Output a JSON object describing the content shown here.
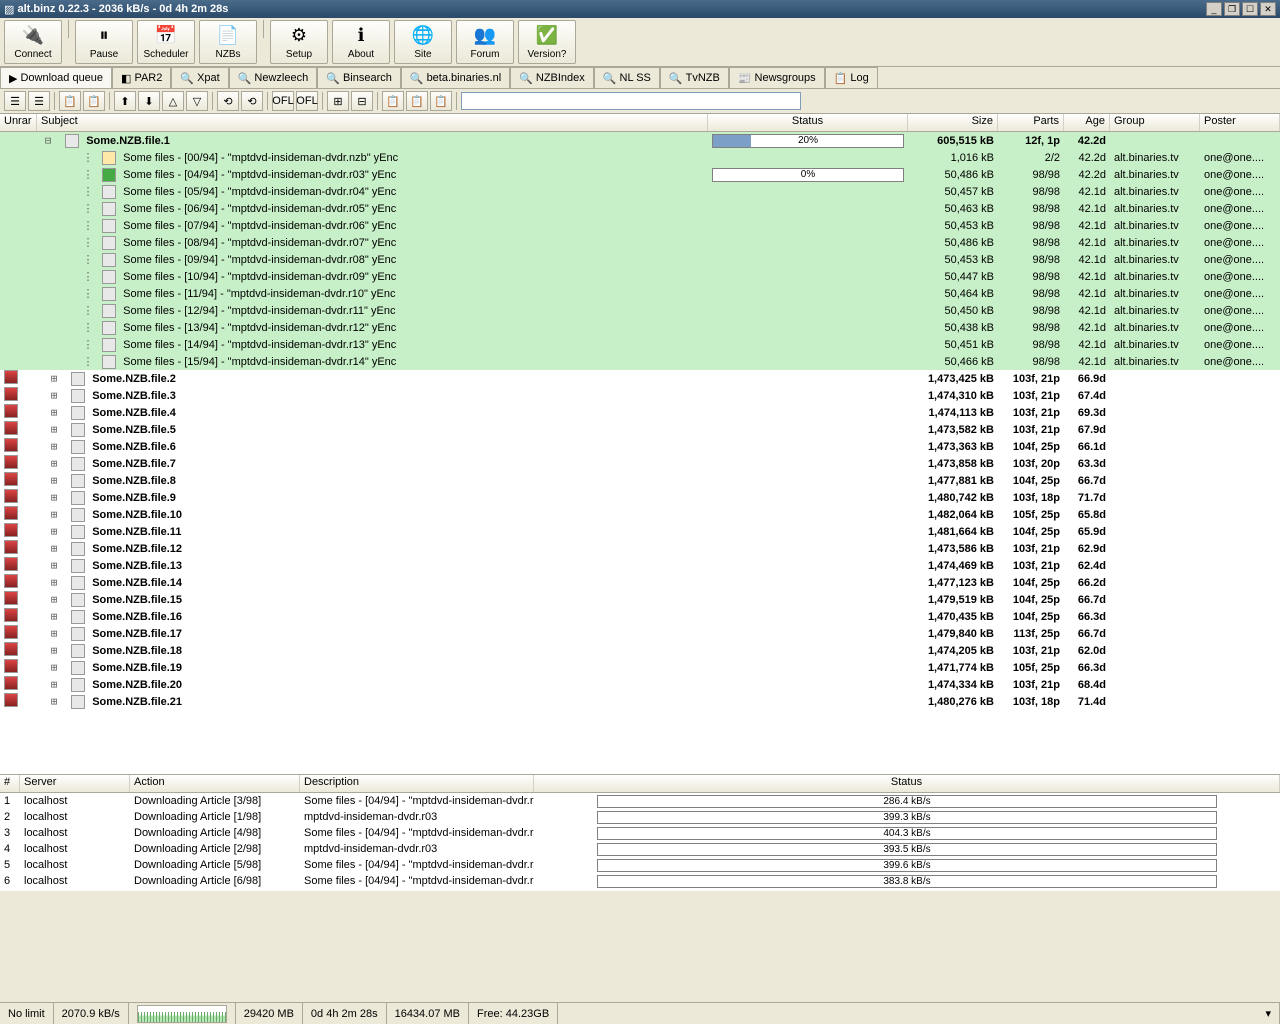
{
  "window": {
    "title": "alt.binz 0.22.3 - 2036 kB/s - 0d 4h 2m 28s"
  },
  "toolbar": [
    {
      "label": "Connect",
      "icon": "🔌"
    },
    {
      "label": "Pause",
      "icon": "⏸"
    },
    {
      "label": "Scheduler",
      "icon": "📅"
    },
    {
      "label": "NZBs",
      "icon": "📄"
    },
    {
      "label": "Setup",
      "icon": "⚙"
    },
    {
      "label": "About",
      "icon": "ℹ"
    },
    {
      "label": "Site",
      "icon": "🌐"
    },
    {
      "label": "Forum",
      "icon": "👥"
    },
    {
      "label": "Version?",
      "icon": "✅"
    }
  ],
  "tabs": [
    {
      "label": "Download queue",
      "icon": "▶",
      "active": true
    },
    {
      "label": "PAR2",
      "icon": "◧"
    },
    {
      "label": "Xpat",
      "icon": "🔍"
    },
    {
      "label": "Newzleech",
      "icon": "🔍"
    },
    {
      "label": "Binsearch",
      "icon": "🔍"
    },
    {
      "label": "beta.binaries.nl",
      "icon": "🔍"
    },
    {
      "label": "NZBIndex",
      "icon": "🔍"
    },
    {
      "label": "NL SS",
      "icon": "🔍"
    },
    {
      "label": "TvNZB",
      "icon": "🔍"
    },
    {
      "label": "Newsgroups",
      "icon": "📰"
    },
    {
      "label": "Log",
      "icon": "📋"
    }
  ],
  "minitools": [
    "☰",
    "☰",
    "📋",
    "📋",
    "⬆",
    "⬇",
    "△",
    "▽",
    "⟲",
    "⟲",
    "OFL",
    "OFL",
    "⊞",
    "⊟",
    "📋",
    "📋",
    "📋"
  ],
  "cols": {
    "unrar": "Unrar",
    "subject": "Subject",
    "status": "Status",
    "size": "Size",
    "parts": "Parts",
    "age": "Age",
    "group": "Group",
    "poster": "Poster"
  },
  "toprow": {
    "subject": "Some.NZB.file.1",
    "progress": 20,
    "size": "605,515 kB",
    "parts": "12f, 1p",
    "age": "42.2d"
  },
  "greenrows": [
    {
      "subject": "Some files - [00/94] - \"mptdvd-insideman-dvdr.nzb\" yEnc",
      "size": "1,016 kB",
      "parts": "2/2",
      "age": "42.2d",
      "group": "alt.binaries.tv",
      "poster": "one@one....",
      "icon": "nzb"
    },
    {
      "subject": "Some files - [04/94] - \"mptdvd-insideman-dvdr.r03\" yEnc",
      "progress": 0,
      "size": "50,486 kB",
      "parts": "98/98",
      "age": "42.2d",
      "group": "alt.binaries.tv",
      "poster": "one@one....",
      "icon": "play"
    },
    {
      "subject": "Some files - [05/94] - \"mptdvd-insideman-dvdr.r04\" yEnc",
      "size": "50,457 kB",
      "parts": "98/98",
      "age": "42.1d",
      "group": "alt.binaries.tv",
      "poster": "one@one...."
    },
    {
      "subject": "Some files - [06/94] - \"mptdvd-insideman-dvdr.r05\" yEnc",
      "size": "50,463 kB",
      "parts": "98/98",
      "age": "42.1d",
      "group": "alt.binaries.tv",
      "poster": "one@one...."
    },
    {
      "subject": "Some files - [07/94] - \"mptdvd-insideman-dvdr.r06\" yEnc",
      "size": "50,453 kB",
      "parts": "98/98",
      "age": "42.1d",
      "group": "alt.binaries.tv",
      "poster": "one@one...."
    },
    {
      "subject": "Some files - [08/94] - \"mptdvd-insideman-dvdr.r07\" yEnc",
      "size": "50,486 kB",
      "parts": "98/98",
      "age": "42.1d",
      "group": "alt.binaries.tv",
      "poster": "one@one...."
    },
    {
      "subject": "Some files - [09/94] - \"mptdvd-insideman-dvdr.r08\" yEnc",
      "size": "50,453 kB",
      "parts": "98/98",
      "age": "42.1d",
      "group": "alt.binaries.tv",
      "poster": "one@one...."
    },
    {
      "subject": "Some files - [10/94] - \"mptdvd-insideman-dvdr.r09\" yEnc",
      "size": "50,447 kB",
      "parts": "98/98",
      "age": "42.1d",
      "group": "alt.binaries.tv",
      "poster": "one@one...."
    },
    {
      "subject": "Some files - [11/94] - \"mptdvd-insideman-dvdr.r10\" yEnc",
      "size": "50,464 kB",
      "parts": "98/98",
      "age": "42.1d",
      "group": "alt.binaries.tv",
      "poster": "one@one...."
    },
    {
      "subject": "Some files - [12/94] - \"mptdvd-insideman-dvdr.r11\" yEnc",
      "size": "50,450 kB",
      "parts": "98/98",
      "age": "42.1d",
      "group": "alt.binaries.tv",
      "poster": "one@one...."
    },
    {
      "subject": "Some files - [13/94] - \"mptdvd-insideman-dvdr.r12\" yEnc",
      "size": "50,438 kB",
      "parts": "98/98",
      "age": "42.1d",
      "group": "alt.binaries.tv",
      "poster": "one@one...."
    },
    {
      "subject": "Some files - [14/94] - \"mptdvd-insideman-dvdr.r13\" yEnc",
      "size": "50,451 kB",
      "parts": "98/98",
      "age": "42.1d",
      "group": "alt.binaries.tv",
      "poster": "one@one...."
    },
    {
      "subject": "Some files - [15/94] - \"mptdvd-insideman-dvdr.r14\" yEnc",
      "size": "50,466 kB",
      "parts": "98/98",
      "age": "42.1d",
      "group": "alt.binaries.tv",
      "poster": "one@one...."
    }
  ],
  "nzbrows": [
    {
      "subject": "Some.NZB.file.2",
      "size": "1,473,425 kB",
      "parts": "103f, 21p",
      "age": "66.9d"
    },
    {
      "subject": "Some.NZB.file.3",
      "size": "1,474,310 kB",
      "parts": "103f, 21p",
      "age": "67.4d"
    },
    {
      "subject": "Some.NZB.file.4",
      "size": "1,474,113 kB",
      "parts": "103f, 21p",
      "age": "69.3d"
    },
    {
      "subject": "Some.NZB.file.5",
      "size": "1,473,582 kB",
      "parts": "103f, 21p",
      "age": "67.9d"
    },
    {
      "subject": "Some.NZB.file.6",
      "size": "1,473,363 kB",
      "parts": "104f, 25p",
      "age": "66.1d"
    },
    {
      "subject": "Some.NZB.file.7",
      "size": "1,473,858 kB",
      "parts": "103f, 20p",
      "age": "63.3d"
    },
    {
      "subject": "Some.NZB.file.8",
      "size": "1,477,881 kB",
      "parts": "104f, 25p",
      "age": "66.7d"
    },
    {
      "subject": "Some.NZB.file.9",
      "size": "1,480,742 kB",
      "parts": "103f, 18p",
      "age": "71.7d"
    },
    {
      "subject": "Some.NZB.file.10",
      "size": "1,482,064 kB",
      "parts": "105f, 25p",
      "age": "65.8d"
    },
    {
      "subject": "Some.NZB.file.11",
      "size": "1,481,664 kB",
      "parts": "104f, 25p",
      "age": "65.9d"
    },
    {
      "subject": "Some.NZB.file.12",
      "size": "1,473,586 kB",
      "parts": "103f, 21p",
      "age": "62.9d"
    },
    {
      "subject": "Some.NZB.file.13",
      "size": "1,474,469 kB",
      "parts": "103f, 21p",
      "age": "62.4d"
    },
    {
      "subject": "Some.NZB.file.14",
      "size": "1,477,123 kB",
      "parts": "104f, 25p",
      "age": "66.2d"
    },
    {
      "subject": "Some.NZB.file.15",
      "size": "1,479,519 kB",
      "parts": "104f, 25p",
      "age": "66.7d"
    },
    {
      "subject": "Some.NZB.file.16",
      "size": "1,470,435 kB",
      "parts": "104f, 25p",
      "age": "66.3d"
    },
    {
      "subject": "Some.NZB.file.17",
      "size": "1,479,840 kB",
      "parts": "113f, 25p",
      "age": "66.7d"
    },
    {
      "subject": "Some.NZB.file.18",
      "size": "1,474,205 kB",
      "parts": "103f, 21p",
      "age": "62.0d"
    },
    {
      "subject": "Some.NZB.file.19",
      "size": "1,471,774 kB",
      "parts": "105f, 25p",
      "age": "66.3d"
    },
    {
      "subject": "Some.NZB.file.20",
      "size": "1,474,334 kB",
      "parts": "103f, 21p",
      "age": "68.4d"
    },
    {
      "subject": "Some.NZB.file.21",
      "size": "1,480,276 kB",
      "parts": "103f, 18p",
      "age": "71.4d"
    }
  ],
  "conncols": {
    "num": "#",
    "server": "Server",
    "action": "Action",
    "desc": "Description",
    "status": "Status"
  },
  "conns": [
    {
      "n": 1,
      "srv": "localhost",
      "act": "Downloading Article [3/98]",
      "desc": "Some files - [04/94] - \"mptdvd-insideman-dvdr.r...",
      "stat": "286.4 kB/s"
    },
    {
      "n": 2,
      "srv": "localhost",
      "act": "Downloading Article [1/98]",
      "desc": "mptdvd-insideman-dvdr.r03",
      "stat": "399.3 kB/s"
    },
    {
      "n": 3,
      "srv": "localhost",
      "act": "Downloading Article [4/98]",
      "desc": "Some files - [04/94] - \"mptdvd-insideman-dvdr.r...",
      "stat": "404.3 kB/s"
    },
    {
      "n": 4,
      "srv": "localhost",
      "act": "Downloading Article [2/98]",
      "desc": "mptdvd-insideman-dvdr.r03",
      "stat": "393.5 kB/s"
    },
    {
      "n": 5,
      "srv": "localhost",
      "act": "Downloading Article [5/98]",
      "desc": "Some files - [04/94] - \"mptdvd-insideman-dvdr.r...",
      "stat": "399.6 kB/s"
    },
    {
      "n": 6,
      "srv": "localhost",
      "act": "Downloading Article [6/98]",
      "desc": "Some files - [04/94] - \"mptdvd-insideman-dvdr.r...",
      "stat": "383.8 kB/s"
    }
  ],
  "footer": {
    "limit": "No limit",
    "speed": "2070.9 kB/s",
    "f1": "29420 MB",
    "eta": "0d 4h 2m 28s",
    "f2": "16434.07 MB",
    "free": "Free: 44.23GB"
  }
}
